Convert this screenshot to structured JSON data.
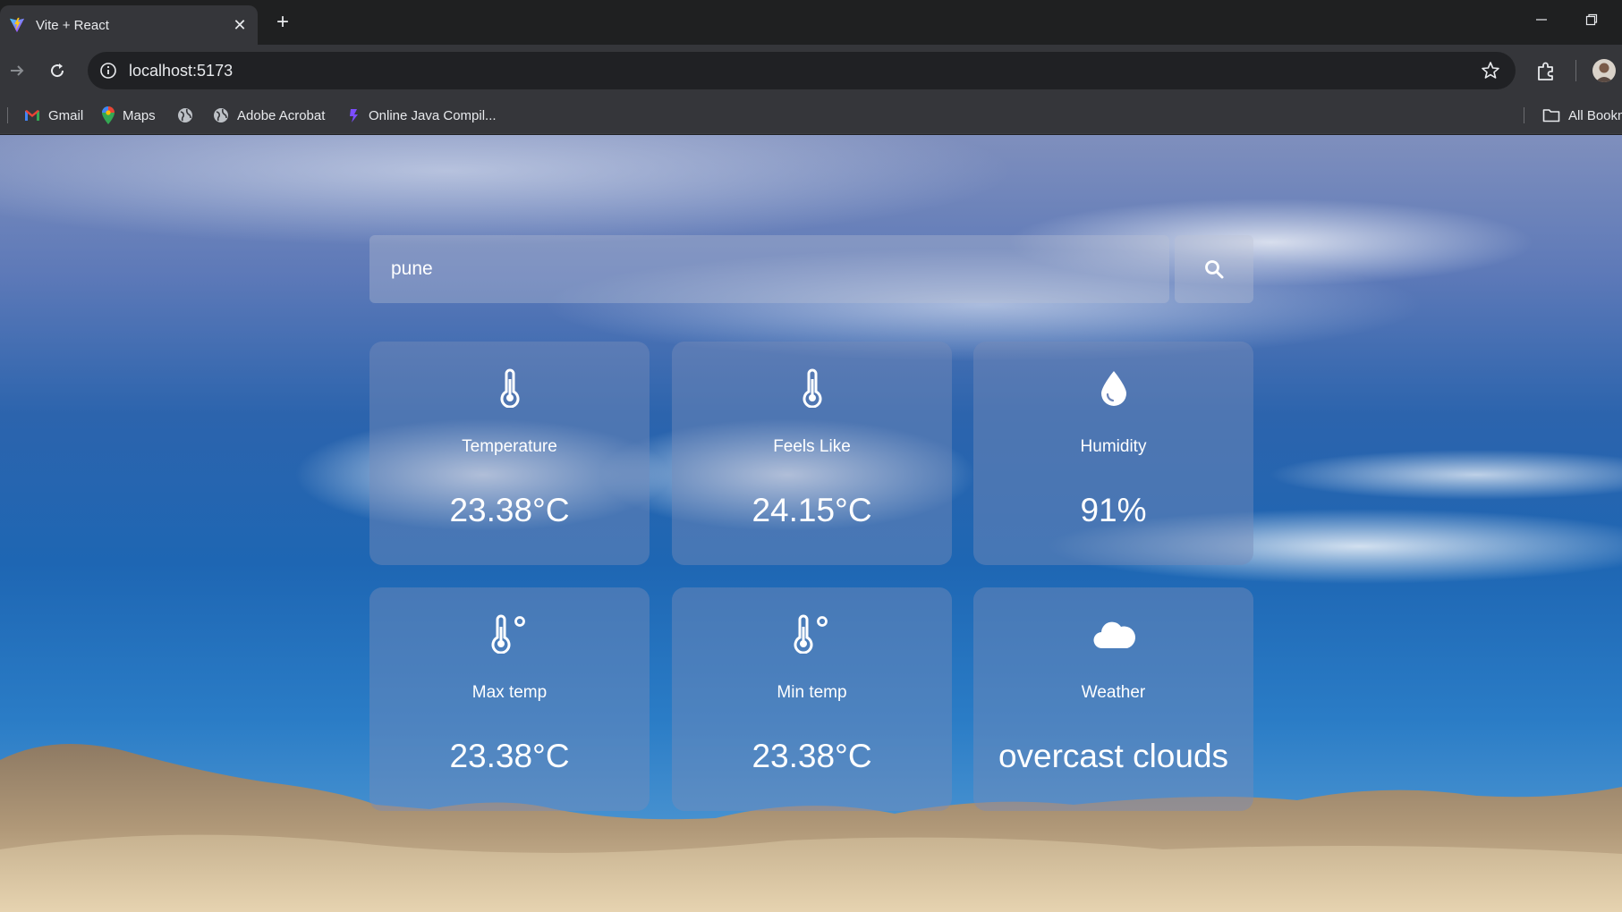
{
  "browser": {
    "tab_title": "Vite + React",
    "tab_close": "✕",
    "new_tab": "+",
    "url": "localhost:5173",
    "bookmarks": [
      {
        "label": "Gmail"
      },
      {
        "label": "Maps"
      },
      {
        "label": ""
      },
      {
        "label": "Adobe Acrobat"
      },
      {
        "label": "Online Java Compil..."
      }
    ],
    "all_bookmarks": "All Bookm"
  },
  "search": {
    "value": "pune"
  },
  "cards": [
    {
      "label": "Temperature",
      "value": "23.38°C",
      "icon": "thermometer-icon"
    },
    {
      "label": "Feels Like",
      "value": "24.15°C",
      "icon": "thermometer-icon"
    },
    {
      "label": "Humidity",
      "value": "91%",
      "icon": "droplet-icon"
    },
    {
      "label": "Max temp",
      "value": "23.38°C",
      "icon": "thermometer-degree-icon"
    },
    {
      "label": "Min temp",
      "value": "23.38°C",
      "icon": "thermometer-degree-icon"
    },
    {
      "label": "Weather",
      "value": "overcast clouds",
      "icon": "cloud-icon"
    }
  ],
  "colors": {
    "chrome_dark": "#1f2021",
    "chrome": "#35363a",
    "card_glass": "rgba(120,140,185,0.45)"
  }
}
